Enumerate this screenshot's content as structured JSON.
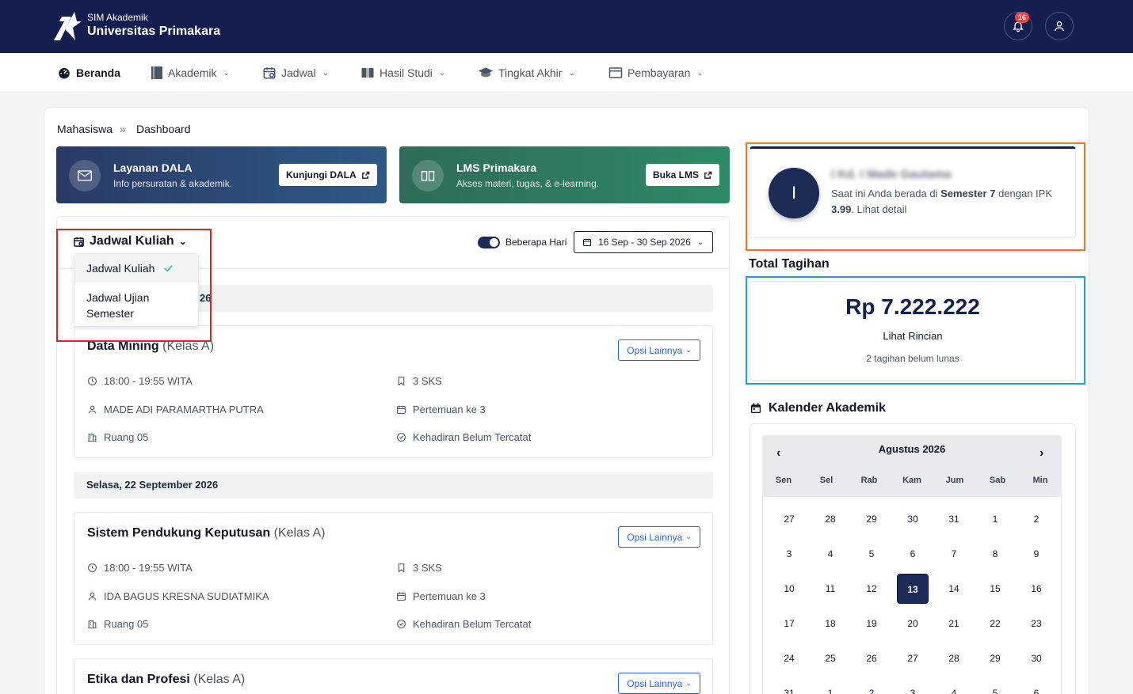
{
  "header": {
    "brand_sub": "SIM Akademik",
    "brand_title": "Universitas Primakara",
    "notif_count": "16",
    "bg_color": "#141f4f"
  },
  "nav": [
    {
      "label": "Beranda",
      "icon": "dashboard-icon"
    },
    {
      "label": "Akademik",
      "icon": "book-icon"
    },
    {
      "label": "Jadwal",
      "icon": "calendar-icon"
    },
    {
      "label": "Hasil Studi",
      "icon": "book-open-icon"
    },
    {
      "label": "Tingkat Akhir",
      "icon": "graduation-cap-icon"
    },
    {
      "label": "Pembayaran",
      "icon": "card-icon"
    }
  ],
  "breadcrumb": {
    "parent": "Mahasiswa",
    "sep": "»",
    "current": "Dashboard"
  },
  "banners": [
    {
      "title": "Layanan DALA",
      "subtitle": "Info persuratan & akademik.",
      "button": "Kunjungi DALA",
      "icon": "mail-icon"
    },
    {
      "title": "LMS Primakara",
      "subtitle": "Akses materi, tugas, & e-learning.",
      "button": "Buka LMS",
      "icon": "book-open-icon"
    }
  ],
  "schedule": {
    "title": "Jadwal Kuliah",
    "toggle_label": "Beberapa Hari",
    "date_range": "16 Sep - 30 Sep 2026",
    "dropdown": [
      "Jadwal Kuliah",
      "Jadwal Ujian Semester"
    ],
    "partial_day_suffix": "26",
    "day2": "Selasa, 22 September 2026",
    "option_label": "Opsi Lainnya",
    "courses": [
      {
        "name": "Data Mining",
        "kelas": "(Kelas A)",
        "time": "18:00 - 19:55 WITA",
        "sks": "3 SKS",
        "lecturer": "MADE ADI PARAMARTHA PUTRA",
        "meeting": "Pertemuan ke 3",
        "room": "Ruang 05",
        "attendance": "Kehadiran Belum Tercatat"
      },
      {
        "name": "Sistem Pendukung Keputusan",
        "kelas": "(Kelas A)",
        "time": "18:00 - 19:55 WITA",
        "sks": "3 SKS",
        "lecturer": "IDA BAGUS KRESNA SUDIATMIKA",
        "meeting": "Pertemuan ke 3",
        "room": "Ruang 05",
        "attendance": "Kehadiran Belum Tercatat"
      },
      {
        "name": "Etika dan Profesi",
        "kelas": "(Kelas A)"
      }
    ]
  },
  "profile": {
    "initial": "I",
    "name_blurred": "I Kd. I Made Gautama",
    "info_pre": "Saat ini Anda berada di ",
    "semester": "Semester 7",
    "info_mid": " dengan IPK ",
    "ipk": "3.99",
    "info_post": ". Lihat detail"
  },
  "tagihan": {
    "title": "Total Tagihan",
    "amount": "Rp 7.222.222",
    "link": "Lihat Rincian",
    "note": "2 tagihan belum lunas"
  },
  "calendar": {
    "title": "Kalender Akademik",
    "month": "Agustus 2026",
    "prev": "‹",
    "next": "›",
    "days_of_week": [
      "Sen",
      "Sel",
      "Rab",
      "Kam",
      "Jum",
      "Sab",
      "Min"
    ],
    "weeks": [
      [
        "27",
        "28",
        "29",
        "30",
        "31",
        "1",
        "2"
      ],
      [
        "3",
        "4",
        "5",
        "6",
        "7",
        "8",
        "9"
      ],
      [
        "10",
        "11",
        "12",
        "13",
        "14",
        "15",
        "16"
      ],
      [
        "17",
        "18",
        "19",
        "20",
        "21",
        "22",
        "23"
      ],
      [
        "24",
        "25",
        "26",
        "27",
        "28",
        "29",
        "30"
      ],
      [
        "31",
        "1",
        "2",
        "3",
        "4",
        "5",
        "6"
      ]
    ],
    "today": "13"
  }
}
